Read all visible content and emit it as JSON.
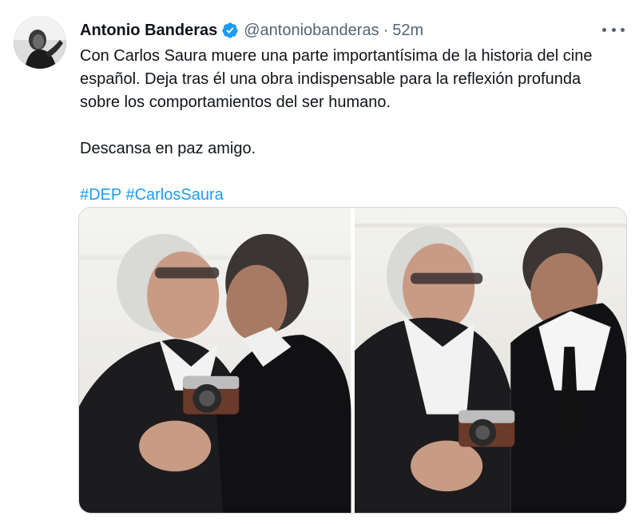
{
  "author": {
    "display_name": "Antonio Banderas",
    "handle": "@antoniobanderas",
    "separator": "·",
    "time": "52m",
    "verified_icon": "verified-badge-icon"
  },
  "tweet": {
    "paragraph1": "Con Carlos Saura muere una parte importantísima de la historia del cine español. Deja tras él una obra indispensable para la reflexión profunda sobre los comportamientos del ser humano.",
    "paragraph2": "Descansa en paz amigo.",
    "hashtags": [
      "#DEP",
      "#CarlosSaura"
    ]
  },
  "menu": {
    "icon": "more-horizontal-icon"
  },
  "colors": {
    "link": "#1d9bf0",
    "secondary_text": "#536471",
    "verified": "#1d9bf0",
    "border": "#cfd9de"
  }
}
